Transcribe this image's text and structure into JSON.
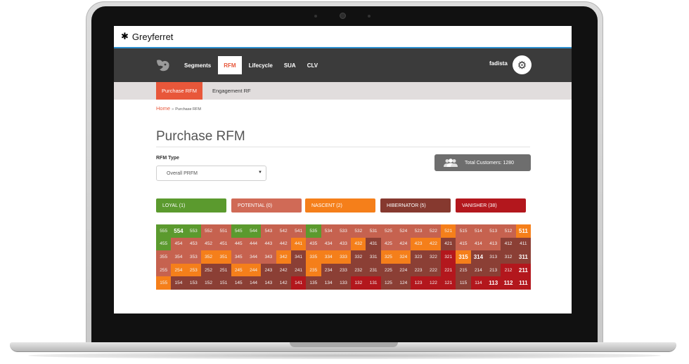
{
  "app": {
    "title": "Greyferret"
  },
  "nav": {
    "items": [
      {
        "label": "Segments",
        "active": false
      },
      {
        "label": "RFM",
        "active": true
      },
      {
        "label": "Lifecycle",
        "active": false
      },
      {
        "label": "SUA",
        "active": false
      },
      {
        "label": "CLV",
        "active": false
      }
    ],
    "user": "fadista"
  },
  "subnav": {
    "items": [
      {
        "label": "Purchase RFM",
        "active": true
      },
      {
        "label": "Engagement RF",
        "active": false
      }
    ]
  },
  "breadcrumb": {
    "home": "Home",
    "separator": "»",
    "current": "Purchase RFM"
  },
  "page": {
    "title": "Purchase RFM"
  },
  "rfm_type": {
    "label": "RFM Type",
    "value": "Overall PRFM"
  },
  "total_customers": {
    "label": "Total Customers: 1280"
  },
  "segments": [
    {
      "label": "LOYAL (1)",
      "color": "#5b9a2e"
    },
    {
      "label": "POTENTIAL (0)",
      "color": "#d06a56"
    },
    {
      "label": "NASCENT (2)",
      "color": "#f57f1a"
    },
    {
      "label": "HIBERNATOR (5)",
      "color": "#86392f"
    },
    {
      "label": "VANISHER (38)",
      "color": "#b3171d"
    }
  ],
  "colors": {
    "green": "#5b9a2e",
    "salmon": "#c6624f",
    "orange": "#f57f1a",
    "brown": "#8b3f35",
    "red": "#b3171d",
    "accent": "#e8573a",
    "nav_bg": "#3b3b3b"
  },
  "grid_rows": [
    {
      "labels": [
        "555",
        "554",
        "553",
        "552",
        "551",
        "545",
        "544",
        "543",
        "542",
        "541",
        "535",
        "534",
        "533",
        "532",
        "531",
        "525",
        "524",
        "523",
        "522",
        "521",
        "515",
        "514",
        "513",
        "512",
        "511"
      ],
      "colors": [
        "green",
        "green",
        "green",
        "salmon",
        "salmon",
        "green",
        "green",
        "salmon",
        "salmon",
        "salmon",
        "green",
        "salmon",
        "salmon",
        "salmon",
        "salmon",
        "salmon",
        "salmon",
        "salmon",
        "salmon",
        "orange",
        "salmon",
        "salmon",
        "salmon",
        "salmon",
        "orange"
      ],
      "highlight": [
        "554",
        "511"
      ]
    },
    {
      "labels": [
        "455",
        "454",
        "453",
        "452",
        "451",
        "445",
        "444",
        "443",
        "442",
        "441",
        "435",
        "434",
        "433",
        "432",
        "431",
        "425",
        "424",
        "423",
        "422",
        "421",
        "415",
        "414",
        "413",
        "412",
        "411"
      ],
      "colors": [
        "green",
        "salmon",
        "salmon",
        "salmon",
        "salmon",
        "salmon",
        "salmon",
        "salmon",
        "salmon",
        "orange",
        "salmon",
        "salmon",
        "salmon",
        "orange",
        "brown",
        "salmon",
        "salmon",
        "orange",
        "orange",
        "brown",
        "salmon",
        "salmon",
        "salmon",
        "brown",
        "brown"
      ],
      "highlight": []
    },
    {
      "labels": [
        "355",
        "354",
        "353",
        "352",
        "351",
        "345",
        "344",
        "343",
        "342",
        "341",
        "335",
        "334",
        "333",
        "332",
        "331",
        "325",
        "324",
        "323",
        "322",
        "321",
        "315",
        "314",
        "313",
        "312",
        "311"
      ],
      "colors": [
        "salmon",
        "salmon",
        "salmon",
        "orange",
        "orange",
        "salmon",
        "salmon",
        "salmon",
        "orange",
        "brown",
        "orange",
        "orange",
        "orange",
        "brown",
        "brown",
        "orange",
        "orange",
        "brown",
        "brown",
        "red",
        "orange",
        "brown",
        "brown",
        "brown",
        "brown"
      ],
      "highlight": [
        "315",
        "314",
        "311"
      ]
    },
    {
      "labels": [
        "255",
        "254",
        "253",
        "252",
        "251",
        "245",
        "244",
        "243",
        "242",
        "241",
        "235",
        "234",
        "233",
        "232",
        "231",
        "225",
        "224",
        "223",
        "222",
        "221",
        "215",
        "214",
        "213",
        "212",
        "211"
      ],
      "colors": [
        "salmon",
        "orange",
        "orange",
        "brown",
        "brown",
        "orange",
        "orange",
        "brown",
        "brown",
        "brown",
        "orange",
        "brown",
        "brown",
        "brown",
        "brown",
        "brown",
        "brown",
        "brown",
        "brown",
        "red",
        "brown",
        "brown",
        "brown",
        "red",
        "red"
      ],
      "highlight": [
        "211"
      ]
    },
    {
      "labels": [
        "155",
        "154",
        "153",
        "152",
        "151",
        "145",
        "144",
        "143",
        "142",
        "141",
        "135",
        "134",
        "133",
        "132",
        "131",
        "125",
        "124",
        "123",
        "122",
        "121",
        "115",
        "114",
        "113",
        "112",
        "111"
      ],
      "colors": [
        "orange",
        "brown",
        "brown",
        "brown",
        "brown",
        "brown",
        "brown",
        "brown",
        "brown",
        "red",
        "brown",
        "brown",
        "brown",
        "red",
        "red",
        "brown",
        "brown",
        "red",
        "red",
        "red",
        "brown",
        "red",
        "red",
        "red",
        "red"
      ],
      "highlight": [
        "113",
        "112",
        "111"
      ]
    }
  ]
}
